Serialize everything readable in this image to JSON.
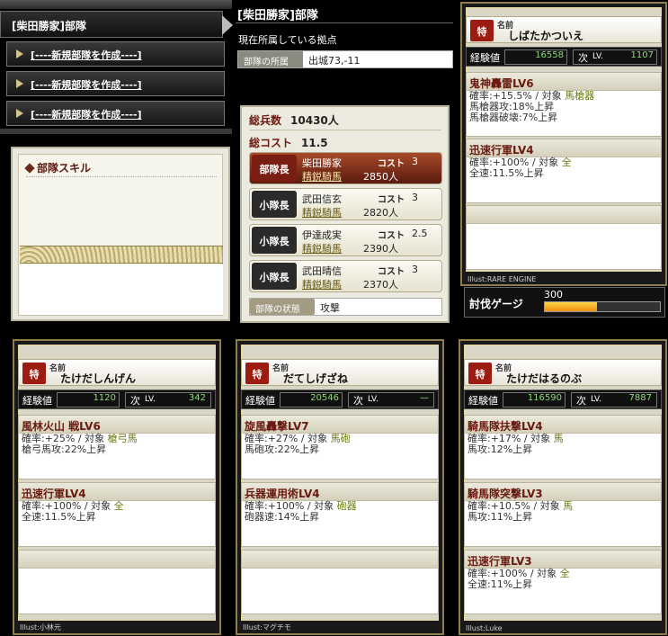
{
  "nav": {
    "header": "[柴田勝家]部隊",
    "items": [
      {
        "label": "[----新規部隊を作成----]"
      },
      {
        "label": "[----新規部隊を作成----]"
      },
      {
        "label": "[----新規部隊を作成----]"
      }
    ]
  },
  "skill_panel": {
    "title": "部隊スキル"
  },
  "unit": {
    "title": "[柴田勝家]部隊",
    "base_heading": "現在所属している拠点",
    "base_label": "部隊の所属",
    "base_value": "出城73,-11"
  },
  "troops": {
    "total_label": "総兵数",
    "total_value": "10430人",
    "cost_label": "総コスト",
    "cost_value": "11.5",
    "cost_key": "コスト",
    "members": [
      {
        "role": "部隊長",
        "name": "柴田勝家",
        "cost": "3",
        "unit": "精鋭騎馬",
        "count": "2850人"
      },
      {
        "role": "小隊長",
        "name": "武田信玄",
        "cost": "3",
        "unit": "精鋭騎馬",
        "count": "2820人"
      },
      {
        "role": "小隊長",
        "name": "伊達成実",
        "cost": "2.5",
        "unit": "精鋭騎馬",
        "count": "2390人"
      },
      {
        "role": "小隊長",
        "name": "武田晴信",
        "cost": "3",
        "unit": "精鋭騎馬",
        "count": "2370人"
      }
    ],
    "status_label": "部隊の状態",
    "status_value": "攻撃"
  },
  "labels": {
    "name": "名前",
    "exp": "経験値",
    "next": "次",
    "lv": "LV.",
    "seal": "特"
  },
  "gauge": {
    "label": "討伐ゲージ",
    "value": "300",
    "fill_fraction": 0.45
  },
  "cards": [
    {
      "name": "しばたかついえ",
      "exp": "16558",
      "next": "1107",
      "skills": [
        {
          "title": "鬼神轟雷LV6",
          "lines": [
            {
              "text": "確率:+15.5% / 対象 ",
              "target": "馬槍器"
            },
            {
              "text": "馬槍器攻:18%上昇"
            },
            {
              "text": "馬槍器破壊:7%上昇"
            }
          ]
        },
        {
          "title": "迅速行軍LV4",
          "lines": [
            {
              "text": "確率:+100% / 対象 ",
              "target": "全"
            },
            {
              "text": "全速:11.5%上昇"
            }
          ]
        },
        {
          "title": "",
          "lines": []
        }
      ],
      "illust": "Illust:RARE ENGINE"
    },
    {
      "name": "たけだしんげん",
      "exp": "1120",
      "next": "342",
      "skills": [
        {
          "title": "風林火山 戦LV6",
          "lines": [
            {
              "text": "確率:+25% / 対象 ",
              "target": "槍弓馬"
            },
            {
              "text": "槍弓馬攻:22%上昇"
            }
          ]
        },
        {
          "title": "迅速行軍LV4",
          "lines": [
            {
              "text": "確率:+100% / 対象 ",
              "target": "全"
            },
            {
              "text": "全速:11.5%上昇"
            }
          ]
        },
        {
          "title": "",
          "lines": []
        }
      ],
      "illust": "Illust:小林元"
    },
    {
      "name": "だてしげざね",
      "exp": "20546",
      "next": "—",
      "skills": [
        {
          "title": "旋風轟撃LV7",
          "lines": [
            {
              "text": "確率:+27% / 対象 ",
              "target": "馬砲"
            },
            {
              "text": "馬砲攻:22%上昇"
            }
          ]
        },
        {
          "title": "兵器運用術LV4",
          "lines": [
            {
              "text": "確率:+100% / 対象 ",
              "target": "砲器"
            },
            {
              "text": "砲器速:14%上昇"
            }
          ]
        },
        {
          "title": "",
          "lines": []
        }
      ],
      "illust": "Illust:マグチモ"
    },
    {
      "name": "たけだはるのぶ",
      "exp": "116590",
      "next": "7887",
      "skills": [
        {
          "title": "騎馬隊扶撃LV4",
          "lines": [
            {
              "text": "確率:+17% / 対象 ",
              "target": "馬"
            },
            {
              "text": "馬攻:12%上昇"
            }
          ]
        },
        {
          "title": "騎馬隊突撃LV3",
          "lines": [
            {
              "text": "確率:+10.5% / 対象 ",
              "target": "馬"
            },
            {
              "text": "馬攻:11%上昇"
            }
          ]
        },
        {
          "title": "迅速行軍LV3",
          "lines": [
            {
              "text": "確率:+100% / 対象 ",
              "target": "全"
            },
            {
              "text": "全速:11%上昇"
            }
          ]
        }
      ],
      "illust": "Illust:Luke"
    }
  ]
}
